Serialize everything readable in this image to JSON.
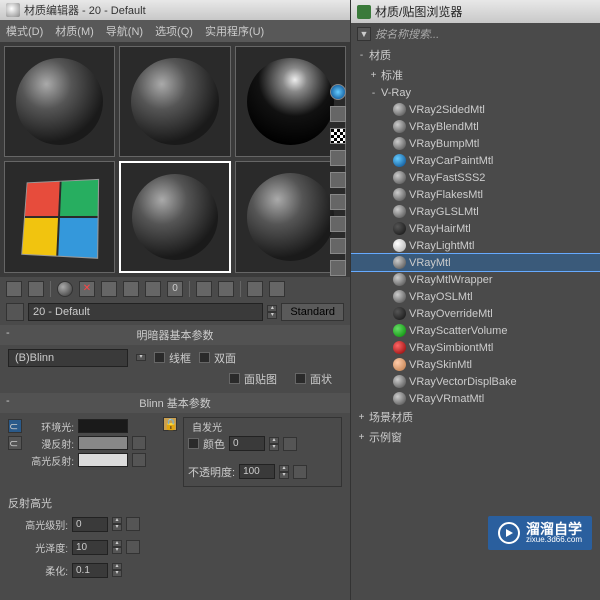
{
  "left_title": "材质编辑器 - 20 - Default",
  "menu": {
    "mode": "模式(D)",
    "material": "材质(M)",
    "navigate": "导航(N)",
    "options": "选项(Q)",
    "util": "实用程序(U)"
  },
  "material_name": "20 - Default",
  "type_btn": "Standard",
  "shader_basic_header": "明暗器基本参数",
  "shader_dropdown": "(B)Blinn",
  "checkboxes": {
    "wire": "线框",
    "two_sided": "双面",
    "face_map": "面贴图",
    "faceted": "面状"
  },
  "blinn_header": "Blinn 基本参数",
  "self_illum": "自发光",
  "color_label": "颜色",
  "color_value": "0",
  "ambient_label": "环境光:",
  "diffuse_label": "漫反射:",
  "specular_label": "高光反射:",
  "opacity_label": "不透明度:",
  "opacity_value": "100",
  "spec_highlights": "反射高光",
  "spec_level_label": "高光级别:",
  "spec_level_value": "0",
  "gloss_label": "光泽度:",
  "gloss_value": "10",
  "soften_label": "柔化:",
  "soften_value": "0.1",
  "right_title": "材质/贴图浏览器",
  "search_placeholder": "按名称搜索...",
  "tree": {
    "root": "材质",
    "standard": "标准",
    "vray": "V-Ray",
    "items": [
      "VRay2SidedMtl",
      "VRayBlendMtl",
      "VRayBumpMtl",
      "VRayCarPaintMtl",
      "VRayFastSSS2",
      "VRayFlakesMtl",
      "VRayGLSLMtl",
      "VRayHairMtl",
      "VRayLightMtl",
      "VRayMtl",
      "VRayMtlWrapper",
      "VRayOSLMtl",
      "VRayOverrideMtl",
      "VRayScatterVolume",
      "VRaySimbiontMtl",
      "VRaySkinMtl",
      "VRayVectorDisplBake",
      "VRayVRmatMtl"
    ],
    "scene_mat": "场景材质",
    "sample": "示例窗"
  },
  "watermark": {
    "brand": "溜溜自学",
    "url": "zixue.3d66.com"
  }
}
